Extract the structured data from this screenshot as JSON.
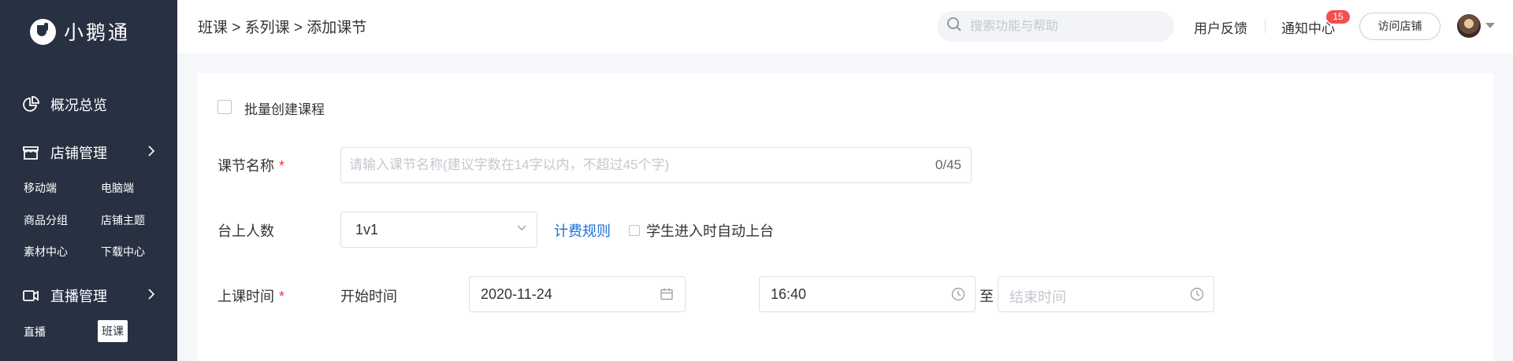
{
  "sidebar": {
    "brand": "小鹅通",
    "groups": [
      {
        "label": "概况总览",
        "icon": "pie-chart-icon"
      },
      {
        "label": "店铺管理",
        "icon": "store-icon"
      },
      {
        "label": "直播管理",
        "icon": "video-camera-icon"
      }
    ],
    "store_items": [
      "移动端",
      "电脑端",
      "商品分组",
      "店铺主题",
      "素材中心",
      "下载中心"
    ],
    "live_items": [
      "直播",
      "班课"
    ],
    "active_item": "班课"
  },
  "header": {
    "breadcrumb": "班课 > 系列课 > 添加课节",
    "search_placeholder": "搜索功能与帮助",
    "feedback": "用户反馈",
    "notifications": "通知中心",
    "notification_count": "15",
    "visit_store": "访问店铺"
  },
  "form": {
    "batch_create_label": "批量创建课程",
    "batch_create_checked": false,
    "name_label": "课节名称",
    "required_mark": "*",
    "name_placeholder": "请输入课节名称(建议字数在14字以内，不超过45个字)",
    "name_value": "",
    "name_counter": "0/45",
    "stage_label": "台上人数",
    "stage_value": "1v1",
    "billing_link": "计费规则",
    "auto_stage_label": "学生进入时自动上台",
    "auto_stage_checked": false,
    "time_label": "上课时间",
    "start_label": "开始时间",
    "start_date": "2020-11-24",
    "start_time": "16:40",
    "to": "至",
    "end_placeholder": "结束时间"
  },
  "colors": {
    "sidebar_bg": "#283142",
    "link": "#1e6fd9",
    "required": "#f03838",
    "badge": "#f05050"
  }
}
